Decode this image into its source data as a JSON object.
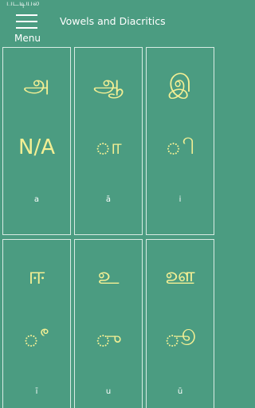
{
  "header": {
    "top_text": "படடியல",
    "menu_label": "Menu",
    "title": "Vowels and Diacritics"
  },
  "cells": [
    {
      "letter": "அ",
      "diacritic": "N/A",
      "translit": "a"
    },
    {
      "letter": "ஆ",
      "diacritic": "◌ா",
      "translit": "ā"
    },
    {
      "letter": "இ",
      "diacritic": "◌ி",
      "translit": "i"
    },
    {
      "letter": "ஈ",
      "diacritic": "◌ீ",
      "translit": "ī"
    },
    {
      "letter": "உ",
      "diacritic": "◌ு",
      "translit": "u"
    },
    {
      "letter": "ஊ",
      "diacritic": "◌ூ",
      "translit": "ū"
    }
  ],
  "colors": {
    "background": "#4b9c81",
    "glyph": "#f3ef94",
    "text": "#ffffff"
  },
  "icons": {
    "menu": "hamburger-menu-icon"
  }
}
